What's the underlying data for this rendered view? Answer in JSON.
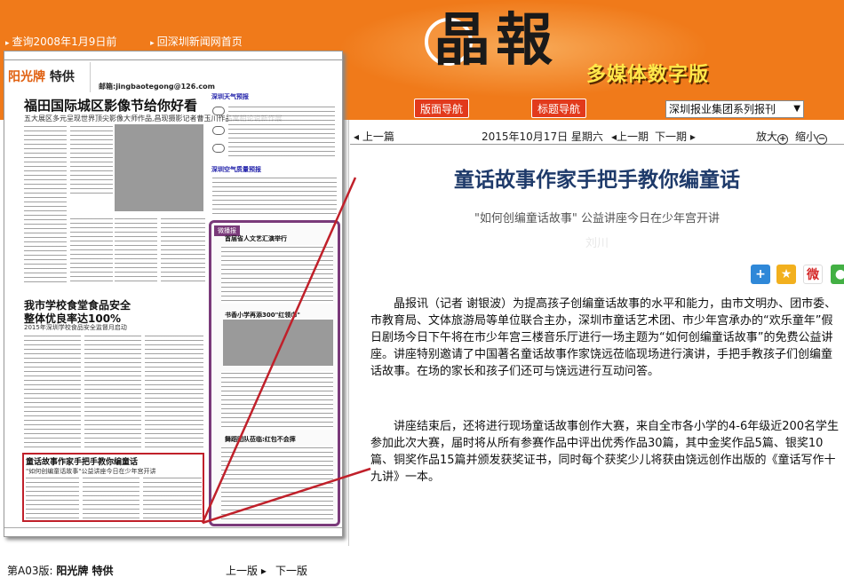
{
  "header": {
    "toplinks": [
      "查询2008年1月9日前",
      "回深圳新闻网首页"
    ],
    "logo_text": "晶報",
    "edition_text": "多媒体数字版",
    "nav_buttons": [
      "版面导航",
      "标题导航"
    ],
    "series_select": "深圳报业集团系列报刊"
  },
  "newspaper": {
    "brand": "阳光牌",
    "brand_suffix": "特供",
    "email": "邮箱:jingbaotegong@126.com",
    "headline_1": "福田国际城区影像节给你好看",
    "headline_1_sub": "五大展区多元呈现世界顶尖影像大师作品,昌现摄影记者曹玉川作品寓相论说新作展",
    "headline_2a": "我市学校食堂食品安全",
    "headline_2b": "整体优良率达100%",
    "headline_2_sub": "2015年深圳学校食品安全监督月启动",
    "weather_title": "深圳天气预报",
    "air_title": "深圳空气质量预报",
    "sidebox_label": "微播报",
    "sidebox_h1": "首届省人文艺汇演举行",
    "sidebox_h2": "书香小学再添300\"红领巾\"",
    "sidebox_h3": "舞蹈团队莅临:红包不会摔",
    "highlight_title": "童话故事作家手把手教你编童话",
    "highlight_sub": "\"如何创编童话故事\"公益讲座今日在少年宫开讲"
  },
  "page_footer": {
    "label": "第A03版:",
    "section": "阳光牌 特供",
    "prev": "上一版",
    "next": "下一版"
  },
  "toolbar": {
    "prev_article": "上一篇",
    "date": "2015年10月17日 星期六",
    "prev_issue": "上一期",
    "next_issue": "下一期",
    "zoom_in": "放大",
    "zoom_out": "缩小"
  },
  "article": {
    "title": "童话故事作家手把手教你编童话",
    "subtitle": "\"如何创编童话故事\" 公益讲座今日在少年宫开讲",
    "subtitle2": "刘川",
    "paragraphs": [
      "晶报讯（记者 谢银波）为提高孩子创编童话故事的水平和能力，由市文明办、团市委、市教育局、文体旅游局等单位联合主办，深圳市童话艺术团、市少年宫承办的“欢乐童年”假日剧场今日下午将在市少年宫三楼音乐厅进行一场主题为“如何创编童话故事”的免费公益讲座。讲座特别邀请了中国著名童话故事作家饶远莅临现场进行演讲，手把手教孩子们创编童话故事。在场的家长和孩子们还可与饶远进行互动问答。",
      "讲座结束后，还将进行现场童话故事创作大赛，来自全市各小学的4-6年级近200名学生参加此次大赛，届时将从所有参赛作品中评出优秀作品30篇，其中金奖作品5篇、银奖10篇、铜奖作品15篇并颁发获奖证书，同时每个获奖少儿将获由饶远创作出版的《童话写作十九讲》一本。"
    ]
  },
  "share": {
    "plus_glyph": "+",
    "fav_glyph": "★",
    "weibo_glyph": "微",
    "wechat_glyph": "●"
  },
  "colors": {
    "header_orange": "#f07a1a",
    "nav_button_red": "#e23a1c",
    "title_blue": "#1e3a6a",
    "highlight_red": "#c0202a",
    "edition_yellow": "#ffe84a"
  }
}
